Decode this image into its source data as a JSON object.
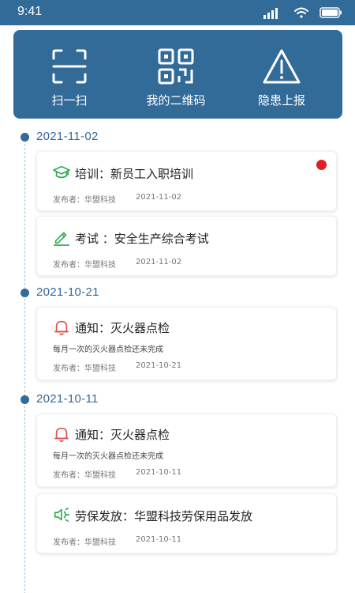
{
  "status": {
    "time": "9:41"
  },
  "quick_actions": [
    {
      "label": "扫一扫",
      "icon": "scan-icon"
    },
    {
      "label": "我的二维码",
      "icon": "qr-code-icon"
    },
    {
      "label": "隐患上报",
      "icon": "warning-icon"
    }
  ],
  "colors": {
    "brand": "#326a98",
    "unread": "#e02020",
    "train": "#2fa84f",
    "notice": "#d9534f"
  },
  "groups": [
    {
      "date": "2021-11-02",
      "items": [
        {
          "title": "培训：新员工入职培训",
          "publisher": "发布者：华盟科技",
          "date": "2021-11-02",
          "icon": "graduation-cap-icon",
          "unread": true
        },
        {
          "title": "考试 ：安全生产综合考试",
          "publisher": "发布者：华盟科技",
          "date": "2021-11-02",
          "icon": "pen-icon"
        }
      ]
    },
    {
      "date": "2021-10-21",
      "items": [
        {
          "title": "通知：灭火器点检",
          "subtitle": "每月一次的灭火器点检还未完成",
          "publisher": "发布者：华盟科技",
          "date": "2021-10-21",
          "icon": "bell-icon"
        }
      ]
    },
    {
      "date": "2021-10-11",
      "items": [
        {
          "title": "通知：灭火器点检",
          "subtitle": "每月一次的灭火器点检还未完成",
          "publisher": "发布者：华盟科技",
          "date": "2021-10-11",
          "icon": "bell-icon"
        },
        {
          "title": "劳保发放：华盟科技劳保用品发放",
          "publisher": "发布者：华盟科技",
          "date": "2021-10-11",
          "icon": "speaker-icon"
        }
      ]
    }
  ]
}
